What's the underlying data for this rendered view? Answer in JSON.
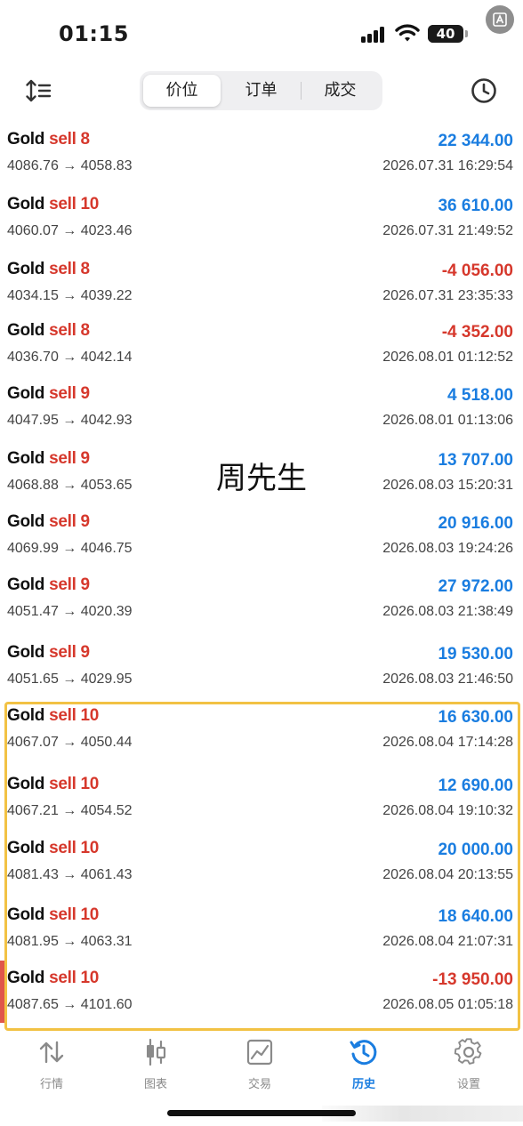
{
  "status_bar": {
    "time": "01:15",
    "battery": "40"
  },
  "toolbar": {
    "tabs": [
      {
        "label": "价位",
        "active": true
      },
      {
        "label": "订单",
        "active": false
      },
      {
        "label": "成交",
        "active": false
      }
    ]
  },
  "deals": [
    {
      "symbol": "Gold",
      "side": "sell 8",
      "prices": "4086.76 → 4058.83",
      "profit": "22 344.00",
      "time": "2026.07.31 16:29:54",
      "negative": false
    },
    {
      "symbol": "Gold",
      "side": "sell 10",
      "prices": "4060.07 → 4023.46",
      "profit": "36 610.00",
      "time": "2026.07.31 21:49:52",
      "negative": false
    },
    {
      "symbol": "Gold",
      "side": "sell 8",
      "prices": "4034.15 → 4039.22",
      "profit": "-4 056.00",
      "time": "2026.07.31 23:35:33",
      "negative": true
    },
    {
      "symbol": "Gold",
      "side": "sell 8",
      "prices": "4036.70 → 4042.14",
      "profit": "-4 352.00",
      "time": "2026.08.01 01:12:52",
      "negative": true
    },
    {
      "symbol": "Gold",
      "side": "sell 9",
      "prices": "4047.95 → 4042.93",
      "profit": "4 518.00",
      "time": "2026.08.01 01:13:06",
      "negative": false
    },
    {
      "symbol": "Gold",
      "side": "sell 9",
      "prices": "4068.88 → 4053.65",
      "profit": "13 707.00",
      "time": "2026.08.03 15:20:31",
      "negative": false
    },
    {
      "symbol": "Gold",
      "side": "sell 9",
      "prices": "4069.99 → 4046.75",
      "profit": "20 916.00",
      "time": "2026.08.03 19:24:26",
      "negative": false
    },
    {
      "symbol": "Gold",
      "side": "sell 9",
      "prices": "4051.47 → 4020.39",
      "profit": "27 972.00",
      "time": "2026.08.03 21:38:49",
      "negative": false
    },
    {
      "symbol": "Gold",
      "side": "sell 9",
      "prices": "4051.65 → 4029.95",
      "profit": "19 530.00",
      "time": "2026.08.03 21:46:50",
      "negative": false
    },
    {
      "symbol": "Gold",
      "side": "sell 10",
      "prices": "4067.07 → 4050.44",
      "profit": "16 630.00",
      "time": "2026.08.04 17:14:28",
      "negative": false
    },
    {
      "symbol": "Gold",
      "side": "sell 10",
      "prices": "4067.21 → 4054.52",
      "profit": "12 690.00",
      "time": "2026.08.04 19:10:32",
      "negative": false
    },
    {
      "symbol": "Gold",
      "side": "sell 10",
      "prices": "4081.43 → 4061.43",
      "profit": "20 000.00",
      "time": "2026.08.04 20:13:55",
      "negative": false
    },
    {
      "symbol": "Gold",
      "side": "sell 10",
      "prices": "4081.95 → 4063.31",
      "profit": "18 640.00",
      "time": "2026.08.04 21:07:31",
      "negative": false
    },
    {
      "symbol": "Gold",
      "side": "sell 10",
      "prices": "4087.65 → 4101.60",
      "profit": "-13 950.00",
      "time": "2026.08.05 01:05:18",
      "negative": true
    }
  ],
  "watermark": "周先生",
  "bottom_nav": [
    {
      "label": "行情",
      "icon": "arrows-up-down-icon",
      "active": false
    },
    {
      "label": "图表",
      "icon": "candlestick-icon",
      "active": false
    },
    {
      "label": "交易",
      "icon": "trade-chart-icon",
      "active": false
    },
    {
      "label": "历史",
      "icon": "history-icon",
      "active": true
    },
    {
      "label": "设置",
      "icon": "gear-icon",
      "active": false
    }
  ],
  "colors": {
    "profit_positive": "#1a7de0",
    "profit_negative": "#d6382c",
    "side_text": "#d6382c",
    "highlight_border": "#f2c244",
    "nav_active": "#1a7de0",
    "nav_inactive": "#8a8a8a"
  }
}
